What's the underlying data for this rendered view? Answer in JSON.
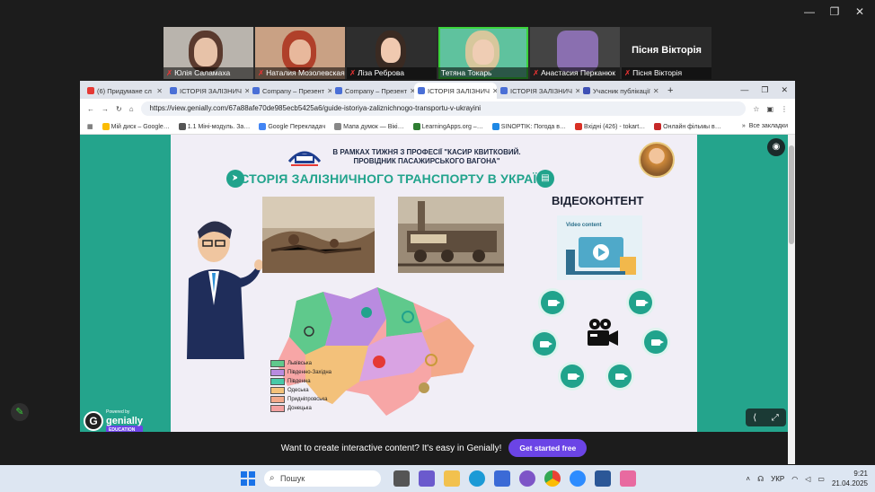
{
  "participants": [
    {
      "name": "Юлія Саламаха",
      "muted": true,
      "active": false
    },
    {
      "name": "Наталия Мозолевская",
      "muted": true,
      "active": false
    },
    {
      "name": "Ліза Реброва",
      "muted": true,
      "active": false
    },
    {
      "name": "Тетяна Токарь",
      "muted": false,
      "active": true
    },
    {
      "name": "Анастасия Перканюк",
      "muted": true,
      "active": false
    },
    {
      "name": "Пісня Вікторія",
      "big_name": "Пісня Вікторія",
      "muted": true,
      "active": false
    }
  ],
  "tabs": [
    {
      "label": "(6) Придумане сл",
      "color": "#e53935"
    },
    {
      "label": "ІСТОРІЯ ЗАЛІЗНИЧ",
      "color": "#4a6fd6"
    },
    {
      "label": "Company – Презент",
      "color": "#4a6fd6"
    },
    {
      "label": "Company – Презент",
      "color": "#4a6fd6"
    },
    {
      "label": "ІСТОРІЯ ЗАЛІЗНИЧ",
      "color": "#4a6fd6"
    },
    {
      "label": "ІСТОРІЯ ЗАЛІЗНИЧ",
      "color": "#4a6fd6"
    },
    {
      "label": "Учасник публікації",
      "color": "#3f51b5"
    }
  ],
  "url": "https://view.genially.com/67a88afe70de985ecb5425a6/guide-istoriya-zaliznichnogo-transportu-v-ukrayini",
  "bookmarks": [
    "Мій диск – Google…",
    "1.1 Міні-модуль. За…",
    "Google Перекладач",
    "Мапа думок — Вікі…",
    "LearningApps.org –…",
    "SINOPTIK: Погода в…",
    "Вхідні (426) - tokart…",
    "Онлайн фільмы в…"
  ],
  "bookmarks_all": "Все закладки",
  "slide": {
    "header_line1": "В РАМКАХ ТИЖНЯ З ПРОФЕСІЇ \"КАСИР КВИТКОВИЙ.",
    "header_line2": "ПРОВІДНИК ПАСАЖИРСЬКОГО ВАГОНА\"",
    "title": "ІСТОРІЯ ЗАЛІЗНИЧНОГО ТРАНСПОРТУ В УКРАЇНІ",
    "video_title": "ВІДЕОКОНТЕНТ",
    "video_card_label": "Video content",
    "legend": [
      "Львівська",
      "Південно-Західна",
      "Південна",
      "Одеська",
      "Придніпровська",
      "Донецька"
    ],
    "legend_colors": [
      "#5fc98c",
      "#b98be0",
      "#46c9a8",
      "#f4c27a",
      "#f3a98a",
      "#f3a0a0"
    ],
    "genially_powered": "Powered by",
    "genially_name": "genially",
    "genially_edu": "EDUCATION"
  },
  "banner": {
    "text": "Want to create interactive content? It's easy in Genially!",
    "cta": "Get started free"
  },
  "taskbar": {
    "search": "Пошук",
    "lang": "УКР",
    "time": "9:21",
    "date": "21.04.2025"
  }
}
